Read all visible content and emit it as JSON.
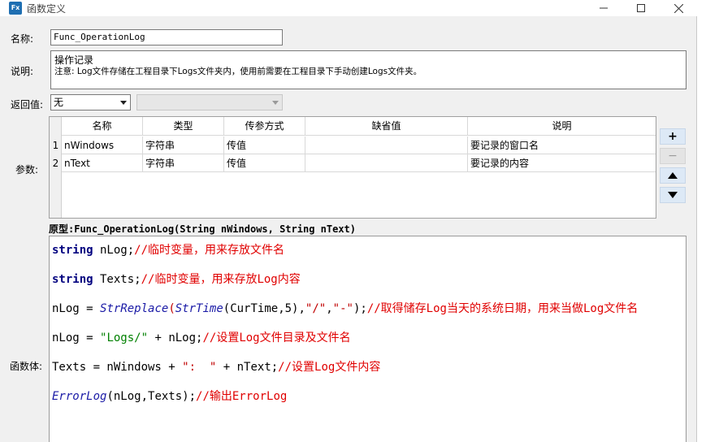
{
  "window": {
    "title": "函数定义",
    "icon": "Fx"
  },
  "form": {
    "name_label": "名称:",
    "name_value": "Func_OperationLog",
    "desc_label": "说明:",
    "desc_line1": "操作记录",
    "desc_line2": "注意: Log文件存储在工程目录下Logs文件夹内，使用前需要在工程目录下手动创建Logs文件夹。",
    "return_label": "返回值:",
    "return_value": "无",
    "params_label": "参数:",
    "body_label": "函数体:"
  },
  "params": {
    "headers": [
      "名称",
      "类型",
      "传参方式",
      "缺省值",
      "说明"
    ],
    "rows": [
      {
        "num": "1",
        "name": "nWindows",
        "type": "字符串",
        "mode": "传值",
        "default": "",
        "desc": "要记录的窗口名"
      },
      {
        "num": "2",
        "name": "nText",
        "type": "字符串",
        "mode": "传值",
        "default": "",
        "desc": "要记录的内容"
      }
    ]
  },
  "side_buttons": {
    "add": "+",
    "remove": "−"
  },
  "prototype": "原型:Func_OperationLog(String nWindows, String nText)",
  "code": {
    "l1_kw": "string",
    "l1_rest": " nLog;",
    "l1_cm": "//临时变量，用来存放文件名",
    "l2_kw": "string",
    "l2_rest": " Texts;",
    "l2_cm": "//临时变量，用来存放Log内容",
    "l3_a": "nLog = ",
    "l3_fn1": "StrReplace",
    "l3_p1": "(",
    "l3_fn2": "StrTime",
    "l3_b": "(CurTime,5),",
    "l3_s1": "\"/\"",
    "l3_c": ",",
    "l3_s2": "\"-\"",
    "l3_d": ");",
    "l3_cm": "//取得储存Log当天的系统日期，用来当做Log文件名",
    "l4_a": "nLog = ",
    "l4_s": "\"Logs/\"",
    "l4_b": " + nLog;",
    "l4_cm": "//设置Log文件目录及文件名",
    "l5_a": "Texts = nWindows + ",
    "l5_s": "\":  \"",
    "l5_b": " + nText;",
    "l5_cm": "//设置Log文件内容",
    "l6_fn": "ErrorLog",
    "l6_b": "(nLog,Texts);",
    "l6_cm": "//输出ErrorLog"
  }
}
